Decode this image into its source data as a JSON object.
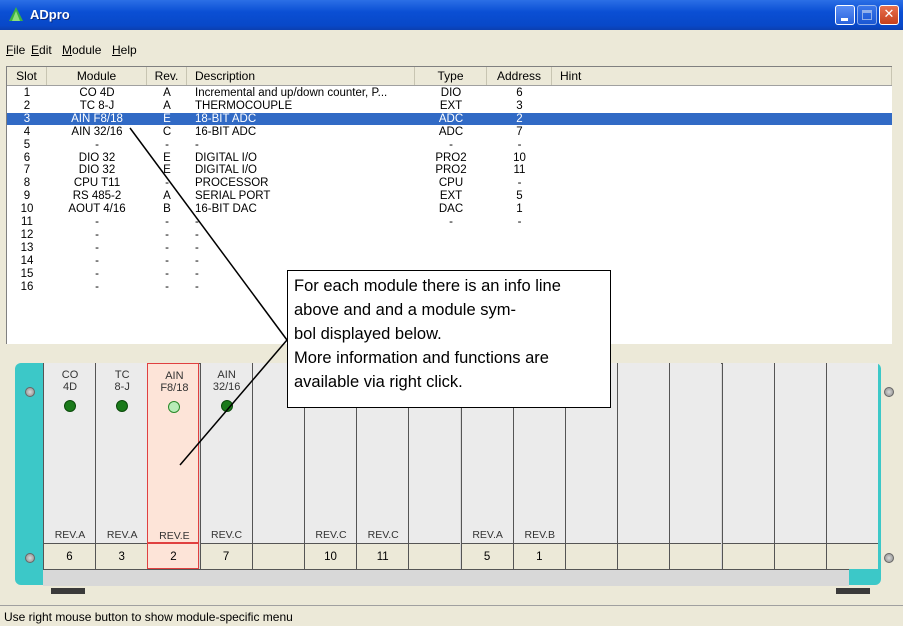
{
  "window": {
    "title": "ADpro"
  },
  "menu": [
    "File",
    "Edit",
    "Module",
    "Help"
  ],
  "table": {
    "headers": [
      "Slot",
      "Module",
      "Rev.",
      "Description",
      "Type",
      "Address",
      "Hint"
    ],
    "rows": [
      [
        "1",
        "CO 4D",
        "A",
        "Incremental and up/down counter, P...",
        "DIO",
        "6",
        ""
      ],
      [
        "2",
        "TC 8-J",
        "A",
        "THERMOCOUPLE",
        "EXT",
        "3",
        ""
      ],
      [
        "3",
        "AIN F8/18",
        "E",
        "18-BIT ADC",
        "ADC",
        "2",
        ""
      ],
      [
        "4",
        "AIN 32/16",
        "C",
        "16-BIT ADC",
        "ADC",
        "7",
        ""
      ],
      [
        "5",
        "-",
        "-",
        "-",
        "-",
        "-",
        ""
      ],
      [
        "6",
        "DIO 32",
        "E",
        "DIGITAL I/O",
        "PRO2",
        "10",
        ""
      ],
      [
        "7",
        "DIO 32",
        "E",
        "DIGITAL I/O",
        "PRO2",
        "11",
        ""
      ],
      [
        "8",
        "CPU T11",
        "-",
        "PROCESSOR",
        "CPU",
        "-",
        ""
      ],
      [
        "9",
        "RS 485-2",
        "A",
        "SERIAL PORT",
        "EXT",
        "5",
        ""
      ],
      [
        "10",
        "AOUT 4/16",
        "B",
        "16-BIT DAC",
        "DAC",
        "1",
        ""
      ],
      [
        "11",
        "-",
        "-",
        "-",
        "-",
        "-",
        ""
      ],
      [
        "12",
        "-",
        "-",
        "-",
        "",
        "",
        ""
      ],
      [
        "13",
        "-",
        "-",
        "-",
        "",
        "",
        ""
      ],
      [
        "14",
        "-",
        "-",
        "-",
        "",
        "",
        ""
      ],
      [
        "15",
        "-",
        "-",
        "-",
        "",
        "",
        ""
      ],
      [
        "16",
        "-",
        "-",
        "-",
        "",
        "",
        ""
      ]
    ],
    "selected_row": 3
  },
  "rack": {
    "slots": [
      {
        "l1": "CO",
        "l2": "4D",
        "rev": "REV.A",
        "addr": "6",
        "led": "dark"
      },
      {
        "l1": "TC",
        "l2": "8-J",
        "rev": "REV.A",
        "addr": "3",
        "led": "dark"
      },
      {
        "l1": "AIN",
        "l2": "F8/18",
        "rev": "REV.E",
        "addr": "2",
        "led": "light",
        "selected": true
      },
      {
        "l1": "AIN",
        "l2": "32/16",
        "rev": "REV.C",
        "addr": "7",
        "led": "dark"
      },
      {
        "l1": "",
        "l2": "",
        "rev": "",
        "addr": "",
        "led": ""
      },
      {
        "l1": "",
        "l2": "",
        "rev": "REV.C",
        "addr": "10",
        "led": ""
      },
      {
        "l1": "",
        "l2": "",
        "rev": "REV.C",
        "addr": "11",
        "led": ""
      },
      {
        "l1": "",
        "l2": "",
        "rev": "",
        "addr": "",
        "led": ""
      },
      {
        "l1": "",
        "l2": "",
        "rev": "REV.A",
        "addr": "5",
        "led": ""
      },
      {
        "l1": "",
        "l2": "",
        "rev": "REV.B",
        "addr": "1",
        "led": ""
      },
      {
        "l1": "",
        "l2": "",
        "rev": "",
        "addr": "",
        "led": ""
      },
      {
        "l1": "",
        "l2": "",
        "rev": "",
        "addr": "",
        "led": ""
      },
      {
        "l1": "",
        "l2": "",
        "rev": "",
        "addr": "",
        "led": ""
      },
      {
        "l1": "",
        "l2": "",
        "rev": "",
        "addr": "",
        "led": ""
      },
      {
        "l1": "",
        "l2": "",
        "rev": "",
        "addr": "",
        "led": ""
      },
      {
        "l1": "",
        "l2": "",
        "rev": "",
        "addr": "",
        "led": ""
      }
    ]
  },
  "callout": {
    "text": "For each module there is an info line above and and a module sym-\nbol displayed below.\nMore information and functions are available via right click."
  },
  "status": {
    "text": "Use right mouse button to show module-specific menu"
  },
  "colors": {
    "selection": "#316ac5",
    "rail": "#3cc8c8",
    "selected_slot_border": "#e04040",
    "titlebar": "#0848c8"
  }
}
